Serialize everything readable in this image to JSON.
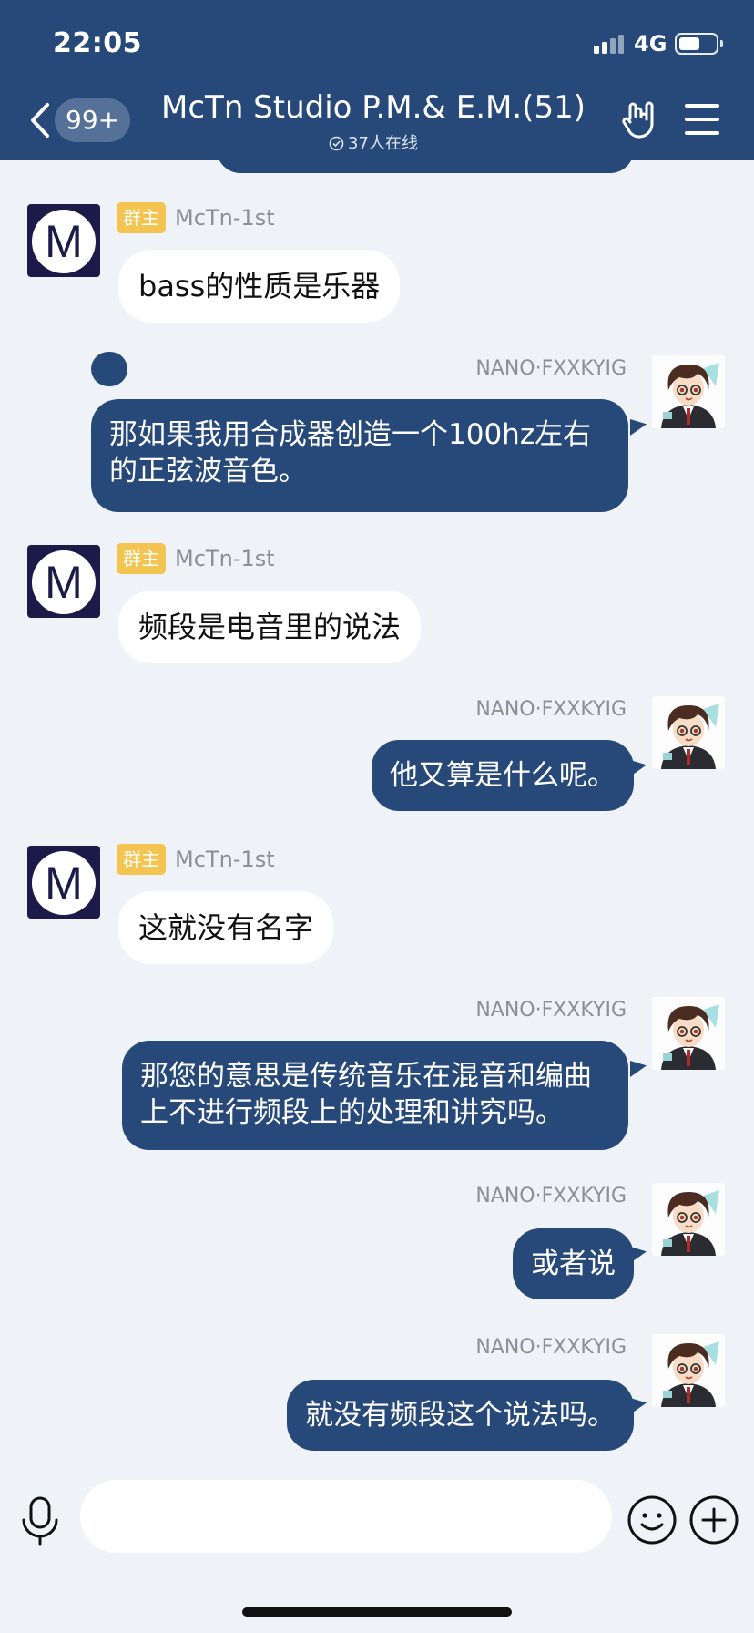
{
  "status_bar": {
    "time": "22:05",
    "network": "4G"
  },
  "header": {
    "unread_count": "99+",
    "title": "McTn Studio P.M.& E.M.(51)",
    "online_text": "37人在线"
  },
  "messages": [
    {
      "sender": "McTn-1st",
      "role_badge": "群主",
      "text": "bass的性质是乐器",
      "direction": "incoming"
    },
    {
      "sender": "NANO·FXXKYIG",
      "lines": [
        "那如果我用合成器创造一个100hz左右",
        "的正弦波音色。"
      ],
      "direction": "outgoing"
    },
    {
      "sender": "McTn-1st",
      "role_badge": "群主",
      "text": "频段是电音里的说法",
      "direction": "incoming"
    },
    {
      "sender": "NANO·FXXKYIG",
      "text": "他又算是什么呢。",
      "direction": "outgoing"
    },
    {
      "sender": "McTn-1st",
      "role_badge": "群主",
      "text": "这就没有名字",
      "direction": "incoming"
    },
    {
      "sender": "NANO·FXXKYIG",
      "lines": [
        "那您的意思是传统音乐在混音和编曲",
        "上不进行频段上的处理和讲究吗。"
      ],
      "direction": "outgoing"
    },
    {
      "sender": "NANO·FXXKYIG",
      "text": "或者说",
      "direction": "outgoing"
    },
    {
      "sender": "NANO·FXXKYIG",
      "text": "就没有频段这个说法吗。",
      "direction": "outgoing"
    }
  ],
  "avatars": {
    "group_owner_letter": "M"
  },
  "input": {
    "value": "",
    "placeholder": ""
  },
  "colors": {
    "accent": "#27497a",
    "background": "#eff2f7",
    "owner_badge": "#f3c44f"
  },
  "icons": [
    "back-icon",
    "gesture-icon",
    "menu-icon",
    "voice-icon",
    "emoji-icon",
    "plus-icon"
  ]
}
